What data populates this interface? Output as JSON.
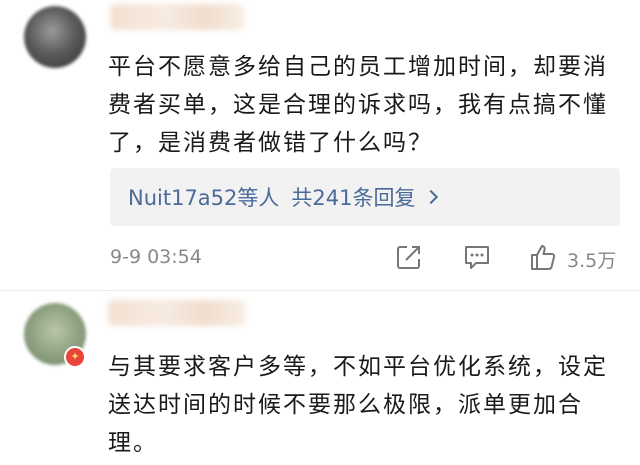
{
  "comments": [
    {
      "text": "平台不愿意多给自己的员工增加时间，却要消费者买单，这是合理的诉求吗，我有点搞不懂了，是消费者做错了什么吗？",
      "replies": {
        "users_label": "Nuit17a52等人",
        "count_label": "共241条回复"
      },
      "timestamp": "9-9 03:54",
      "like_count": "3.5万",
      "icons": [
        "share-icon",
        "comment-icon",
        "thumbs-up-icon"
      ]
    },
    {
      "text": "与其要求客户多等，不如平台优化系统，设定送达时间的时候不要那么极限，派单更加合理。",
      "badge_icon": "vip-badge-icon"
    }
  ],
  "colors": {
    "link": "#4b6a99",
    "meta": "#888888",
    "reply_bg": "#f2f2f2",
    "badge": "#e8463a"
  }
}
